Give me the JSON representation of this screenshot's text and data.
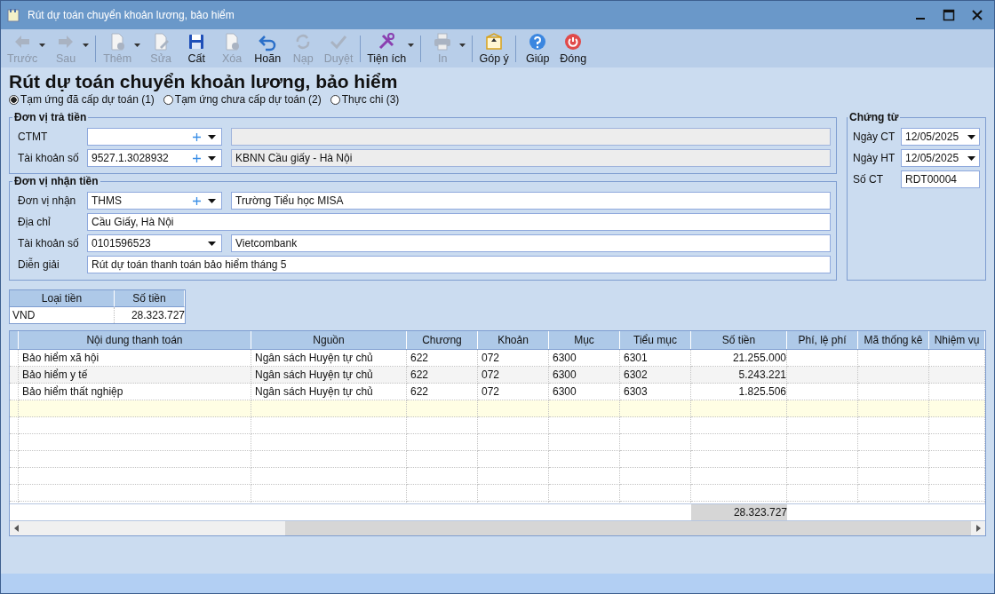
{
  "window": {
    "title": "Rút dự toán chuyển khoản lương, bảo hiểm"
  },
  "toolbar": {
    "groups": [
      [
        {
          "label": "Trước",
          "kind": "back",
          "disabled": true,
          "dropdown": true
        },
        {
          "label": "Sau",
          "kind": "forward",
          "disabled": true,
          "dropdown": true
        }
      ],
      [
        {
          "label": "Thêm",
          "kind": "add",
          "disabled": true,
          "dropdown": true
        },
        {
          "label": "Sửa",
          "kind": "edit",
          "disabled": true,
          "dropdown": false
        },
        {
          "label": "Cất",
          "kind": "save",
          "disabled": false,
          "dropdown": false
        },
        {
          "label": "Xóa",
          "kind": "delete",
          "disabled": true,
          "dropdown": false
        },
        {
          "label": "Hoãn",
          "kind": "undo",
          "disabled": false,
          "dropdown": false
        },
        {
          "label": "Nạp",
          "kind": "reload",
          "disabled": true,
          "dropdown": false
        },
        {
          "label": "Duyệt",
          "kind": "check",
          "disabled": true,
          "dropdown": false
        }
      ],
      [
        {
          "label": "Tiện ích",
          "kind": "tools",
          "disabled": false,
          "dropdown": true
        }
      ],
      [
        {
          "label": "In",
          "kind": "print",
          "disabled": true,
          "dropdown": true
        }
      ],
      [
        {
          "label": "Góp ý",
          "kind": "mail",
          "disabled": false,
          "dropdown": false
        }
      ],
      [
        {
          "label": "Giúp",
          "kind": "help",
          "disabled": false,
          "dropdown": false
        },
        {
          "label": "Đóng",
          "kind": "power",
          "disabled": false,
          "dropdown": false
        }
      ]
    ]
  },
  "heading": "Rút dự toán chuyển khoản lương, bảo hiểm",
  "modes": [
    {
      "label": "Tạm ứng đã cấp dự toán (1)",
      "selected": true
    },
    {
      "label": "Tạm ứng chưa cấp dự toán (2)",
      "selected": false
    },
    {
      "label": "Thực chi (3)",
      "selected": false
    }
  ],
  "payer": {
    "title": "Đơn vị trả tiền",
    "fields": [
      {
        "kind": "lookup",
        "label": "CTMT",
        "detail_readonly": true
      },
      {
        "kind": "lookup",
        "label": "Tài khoản số",
        "value": "9527.1.3028932",
        "detail": "KBNN Cầu giấy - Hà Nội",
        "detail_readonly": true
      }
    ]
  },
  "payee": {
    "title": "Đơn vị nhận tiền",
    "fields": [
      {
        "kind": "lookup",
        "label": "Đơn vị nhận",
        "value": "THMS",
        "detail": "Trường Tiểu học MISA",
        "detail_readonly": false
      },
      {
        "kind": "text",
        "label": "Địa chỉ",
        "value": "Cầu Giấy, Hà Nội"
      },
      {
        "kind": "combo",
        "label": "Tài khoản số",
        "value": "0101596523",
        "detail": "Vietcombank",
        "detail_readonly": false
      },
      {
        "kind": "text",
        "label": "Diễn giải",
        "value": "Rút dự toán thanh toán bảo hiểm tháng 5"
      }
    ]
  },
  "voucher": {
    "title": "Chứng từ",
    "fields": [
      {
        "kind": "date",
        "label": "Ngày CT",
        "value": "12/05/2025"
      },
      {
        "kind": "date",
        "label": "Ngày HT",
        "value": "12/05/2025"
      },
      {
        "kind": "text",
        "label": "Số CT",
        "value": "RDT00004"
      }
    ]
  },
  "currency": {
    "columns": [
      "Loại tiền",
      "Số tiền"
    ],
    "rows": [
      [
        "VND",
        "28.323.727"
      ]
    ]
  },
  "grid": {
    "columns": [
      {
        "label": "Nội dung thanh toán",
        "kind": "text"
      },
      {
        "label": "Nguồn",
        "kind": "text"
      },
      {
        "label": "Chương",
        "kind": "text"
      },
      {
        "label": "Khoản",
        "kind": "text"
      },
      {
        "label": "Mục",
        "kind": "text"
      },
      {
        "label": "Tiểu mục",
        "kind": "text"
      },
      {
        "label": "Số tiền",
        "kind": "amount"
      },
      {
        "label": "Phí, lệ phí",
        "kind": "text"
      },
      {
        "label": "Mã thống kê",
        "kind": "text"
      },
      {
        "label": "Nhiệm vụ",
        "kind": "text"
      }
    ],
    "rows": [
      [
        "Bảo hiểm xã hội",
        "Ngân sách Huyện tự chủ",
        "622",
        "072",
        "6300",
        "6301",
        "21.255.000",
        "",
        "",
        ""
      ],
      [
        "Bảo hiểm y tế",
        "Ngân sách Huyện tự chủ",
        "622",
        "072",
        "6300",
        "6302",
        "5.243.221",
        "",
        "",
        ""
      ],
      [
        "Bảo hiểm thất nghiệp",
        "Ngân sách Huyện tự chủ",
        "622",
        "072",
        "6300",
        "6303",
        "1.825.506",
        "",
        "",
        ""
      ]
    ],
    "total": "28.323.727"
  }
}
